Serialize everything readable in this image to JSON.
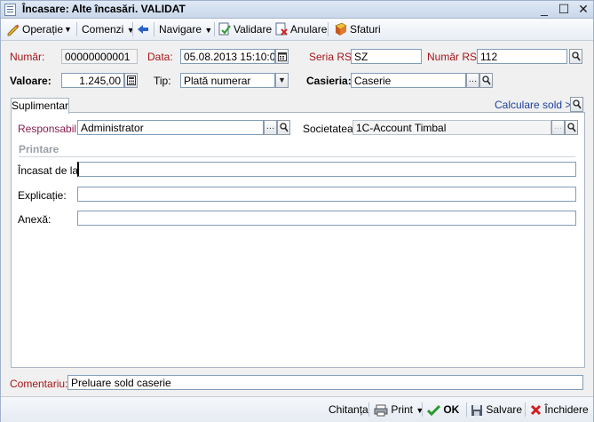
{
  "window": {
    "title": "Încasare: Alte încasări. VALIDAT",
    "minimize": "_",
    "maximize": "☐",
    "close": "✕"
  },
  "toolbar": {
    "operatie": "Operație",
    "comenzi": "Comenzi",
    "navigare": "Navigare",
    "validare": "Validare",
    "anulare": "Anulare",
    "sfaturi": "Sfaturi"
  },
  "header": {
    "numar_label": "Număr:",
    "numar_value": "00000000001",
    "data_label": "Data:",
    "data_value": "05.08.2013 15:10:05",
    "seria_label": "Seria RS:",
    "seria_value": "SZ",
    "numar_rs_label": "Număr RS:",
    "numar_rs_value": "112",
    "valoare_label": "Valoare:",
    "valoare_value": "1.245,00",
    "tip_label": "Tip:",
    "tip_value": "Plată numerar",
    "casieria_label": "Casieria:",
    "casieria_value": "Caserie"
  },
  "tabs": {
    "suplimentar": "Suplimentar",
    "calculare_sold": "Calculare sold >>"
  },
  "suplimentar": {
    "responsabil_label": "Responsabil:",
    "responsabil_value": "Administrator",
    "societatea_label": "Societatea:",
    "societatea_value": "1C-Account Timbal",
    "printare_heading": "Printare",
    "incasat_label": "Încasat de la:",
    "incasat_value": "",
    "explicatie_label": "Explicație:",
    "explicatie_value": "",
    "anexa_label": "Anexă:",
    "anexa_value": ""
  },
  "comentariu": {
    "label": "Comentariu:",
    "value": "Preluare sold caserie"
  },
  "footer": {
    "chitanta": "Chitanța",
    "print": "Print",
    "ok": "OK",
    "salvare": "Salvare",
    "inchidere": "Închidere"
  },
  "colors": {
    "label_red": "#a6151a",
    "title_bg": "#dfe8f5",
    "ok_green": "#2c9a2c",
    "close_red": "#d11f1f"
  }
}
